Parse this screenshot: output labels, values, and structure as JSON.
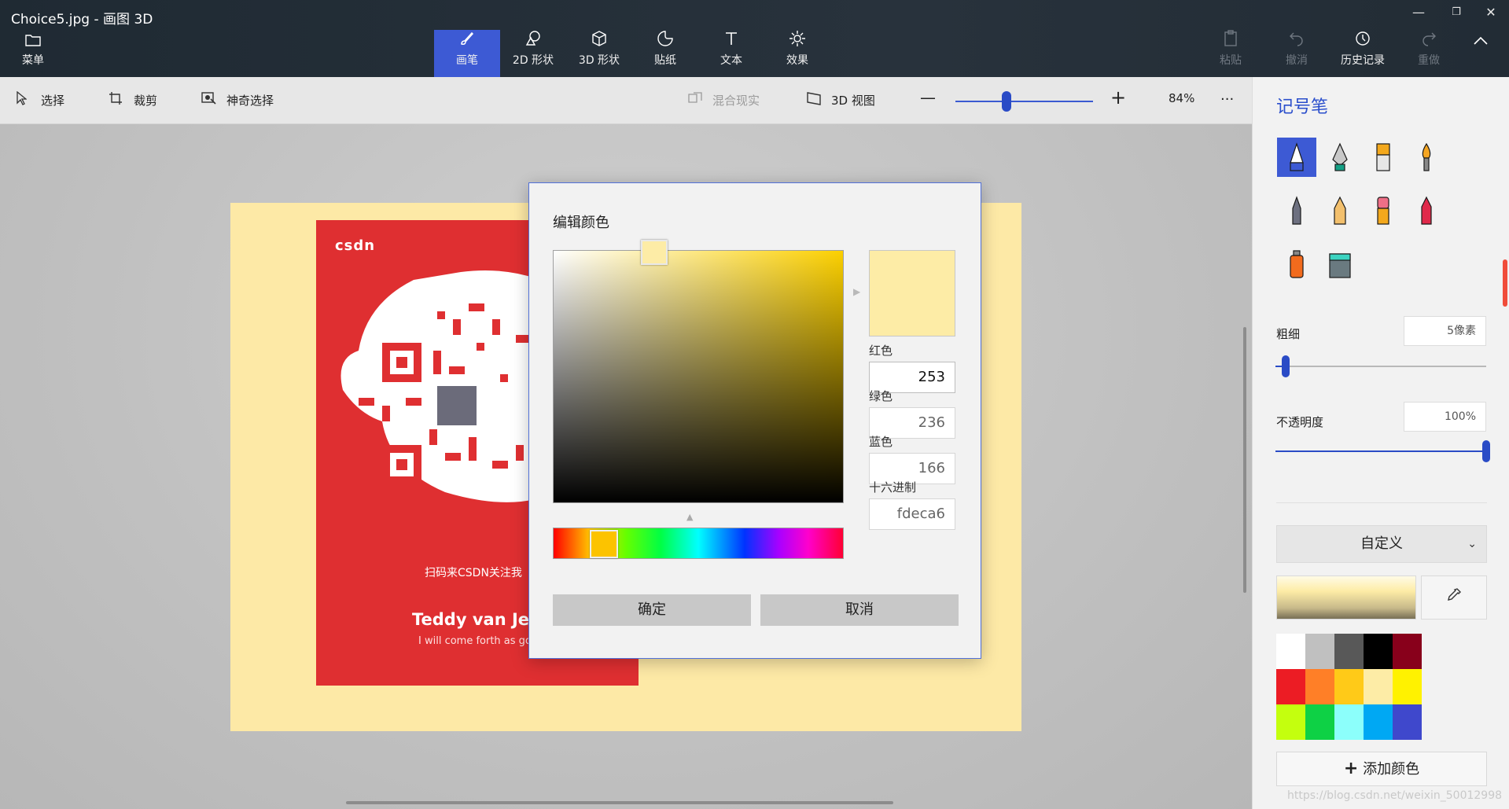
{
  "window": {
    "title": "Choice5.jpg - 画图 3D",
    "controls": [
      "minimize",
      "restore",
      "close"
    ]
  },
  "ribbon": {
    "menu": {
      "label": "菜单",
      "icon": "folder-icon"
    },
    "tabs": [
      {
        "label": "画笔",
        "icon": "brush-icon",
        "active": true
      },
      {
        "label": "2D 形状",
        "icon": "2d-shapes-icon"
      },
      {
        "label": "3D 形状",
        "icon": "3d-cube-icon"
      },
      {
        "label": "贴纸",
        "icon": "sticker-icon"
      },
      {
        "label": "文本",
        "icon": "text-icon"
      },
      {
        "label": "效果",
        "icon": "sun-icon"
      }
    ],
    "actions": [
      {
        "label": "粘贴",
        "icon": "paste-icon",
        "enabled": false
      },
      {
        "label": "撤消",
        "icon": "undo-icon",
        "enabled": false
      },
      {
        "label": "历史记录",
        "icon": "history-icon",
        "enabled": true
      },
      {
        "label": "重做",
        "icon": "redo-icon",
        "enabled": false
      }
    ]
  },
  "toolbar": {
    "select": "选择",
    "crop": "裁剪",
    "magic_select": "神奇选择",
    "mixed_reality": "混合现实",
    "view_3d": "3D 视图",
    "zoom_percent": "84%",
    "zoom_level": 0.37,
    "more": "···"
  },
  "canvas": {
    "paper_color": "#fde9a6",
    "card": {
      "logo": "csdn",
      "scan_text": "扫码来CSDN关注我",
      "name": "Teddy van Jer",
      "subtitle": "I will come forth as gol",
      "color": "#df2f31"
    }
  },
  "dialog": {
    "title": "编辑颜色",
    "red_label": "红色",
    "red_value": "253",
    "green_label": "绿色",
    "green_value": "236",
    "blue_label": "蓝色",
    "blue_value": "166",
    "hex_label": "十六进制",
    "hex_value": "fdeca6",
    "ok_label": "确定",
    "cancel_label": "取消",
    "preview_color": "#fdeca6",
    "hue_color": "#fcc300"
  },
  "panel": {
    "title": "记号笔",
    "brushes": [
      {
        "name": "marker",
        "selected": true
      },
      {
        "name": "calligraphy-pen"
      },
      {
        "name": "oil-brush"
      },
      {
        "name": "watercolor"
      },
      {
        "name": "pixel-pen"
      },
      {
        "name": "pencil"
      },
      {
        "name": "eraser"
      },
      {
        "name": "crayon"
      },
      {
        "name": "spray-can"
      },
      {
        "name": "fill-bucket"
      }
    ],
    "thickness_label": "粗细",
    "thickness_value": "5像素",
    "thickness_level": 0.05,
    "opacity_label": "不透明度",
    "opacity_value": "100%",
    "opacity_level": 1.0,
    "color_mode": "自定义",
    "add_color_label": "添加颜色",
    "palette": [
      "#ffffff",
      "#c0c0c0",
      "#585858",
      "#000000",
      "#88001b",
      "#ec1c24",
      "#ff7f27",
      "#ffca18",
      "#fdeca6",
      "#fff200",
      "#c4ff0e",
      "#0ed145",
      "#8cfffb",
      "#00a8f3",
      "#3f48cc"
    ],
    "accent": "#3d5ad4"
  },
  "watermark": "https://blog.csdn.net/weixin_50012998"
}
